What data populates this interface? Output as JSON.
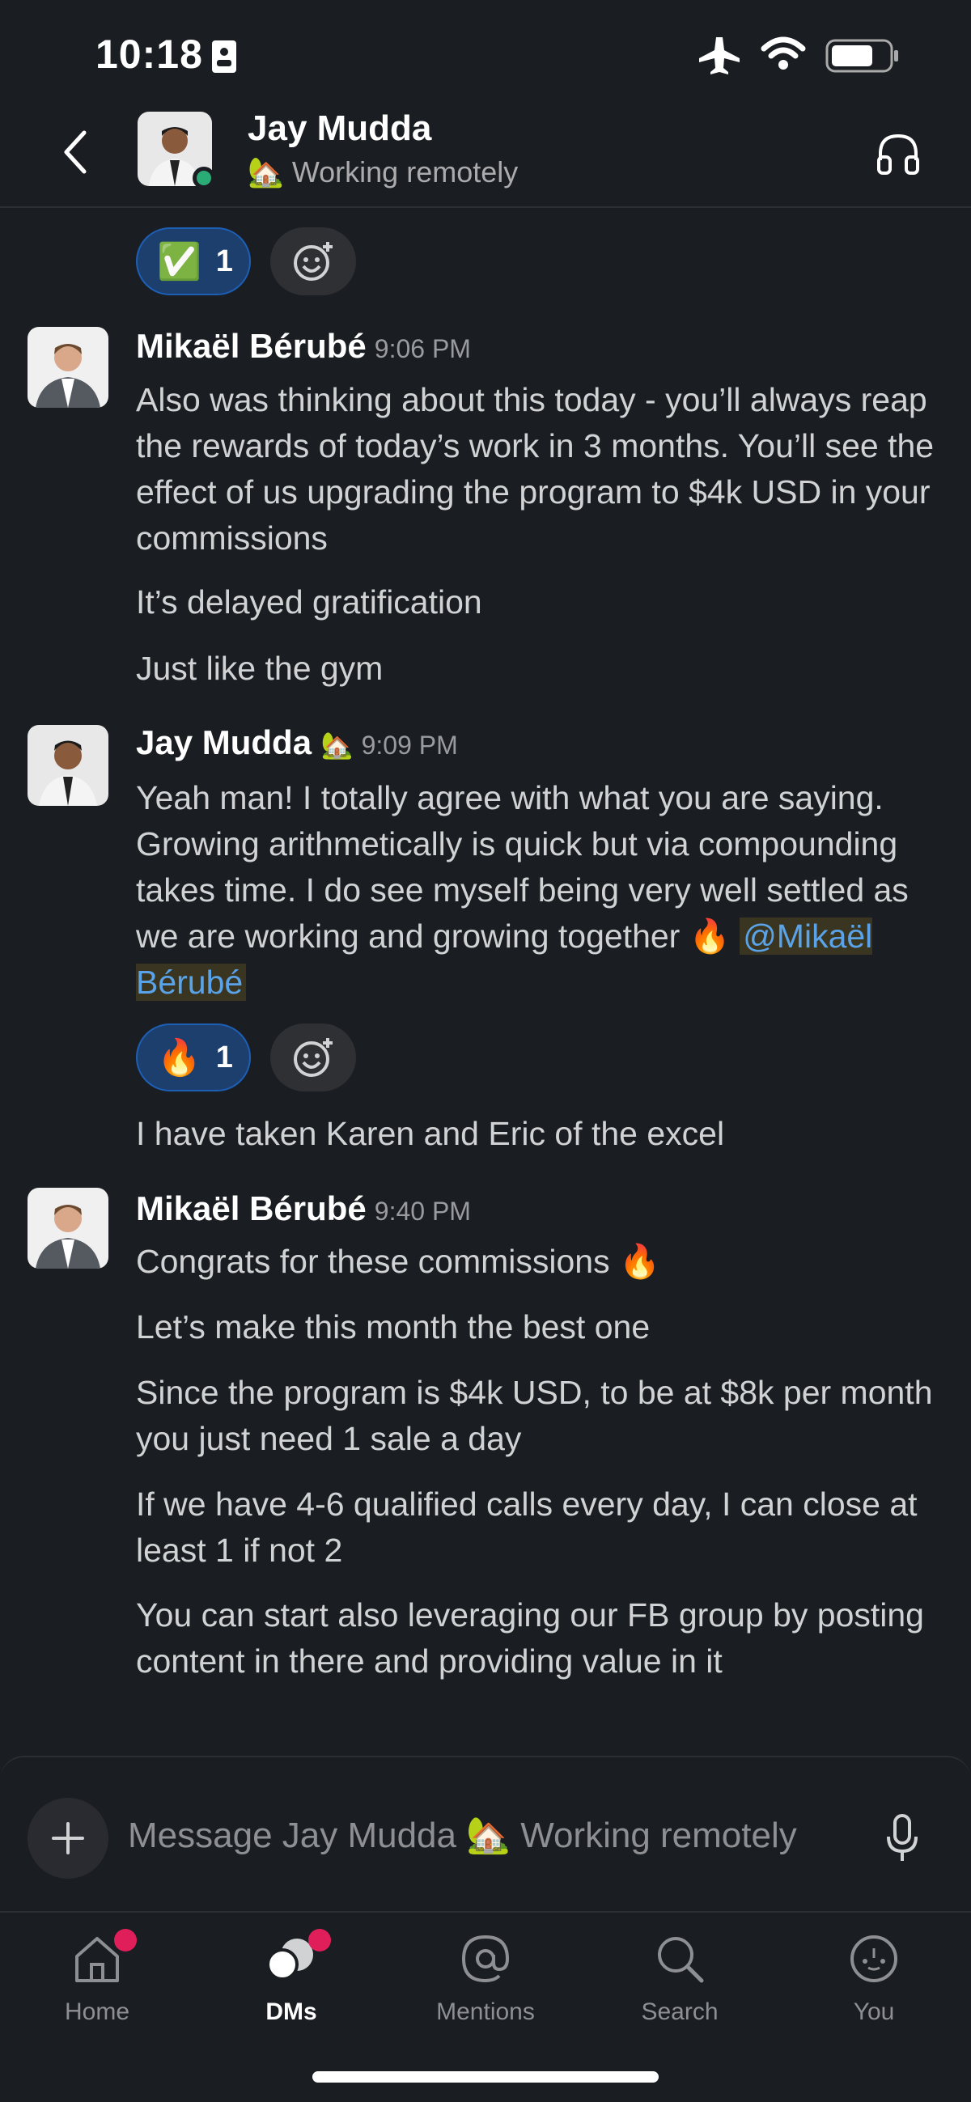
{
  "status_bar": {
    "time": "10:18"
  },
  "header": {
    "name": "Jay Mudda",
    "status": "🏡 Working remotely"
  },
  "reactions": {
    "first": {
      "emoji": "✅",
      "count": "1"
    },
    "second": {
      "emoji": "🔥",
      "count": "1"
    }
  },
  "messages": [
    {
      "author": "Mikaël Bérubé",
      "time": "9:06 PM",
      "lines": [
        "Also was thinking about this today - you’ll always reap the rewards of today’s work in 3 months. You’ll see the effect of us upgrading the program to $4k USD in your commissions",
        "It’s delayed gratification",
        "Just like the gym"
      ]
    },
    {
      "author": "Jay Mudda",
      "author_emoji": "🏡",
      "time": "9:09 PM",
      "lines": [
        "Yeah man! I totally agree with what you are saying. Growing arithmetically is quick but via compounding takes time. I do see myself being very well settled as we are working and growing together 🔥",
        "I have taken Karen and Eric of the excel"
      ],
      "mention": "@Mikaël Bérubé"
    },
    {
      "author": "Mikaël Bérubé",
      "time": "9:40 PM",
      "lines": [
        "Congrats for these commissions 🔥",
        "Let’s make this month the best one",
        "Since the program is $4k USD, to be at $8k per month you just need 1 sale a day",
        "If we have 4-6 qualified calls every day, I can close at least 1 if not 2",
        "You can start also leveraging our FB group by posting content in there and providing value in it"
      ]
    }
  ],
  "composer": {
    "placeholder": "Message Jay Mudda 🏡 Working remotely"
  },
  "tabs": [
    {
      "label": "Home",
      "icon": "home-icon",
      "badge": true
    },
    {
      "label": "DMs",
      "icon": "dms-icon",
      "badge": true,
      "active": true
    },
    {
      "label": "Mentions",
      "icon": "at-icon"
    },
    {
      "label": "Search",
      "icon": "search-icon"
    },
    {
      "label": "You",
      "icon": "profile-icon"
    }
  ],
  "colors": {
    "background": "#1a1d21",
    "accent": "#1d5fb5",
    "badge": "#e01e5a",
    "online": "#2bac76",
    "mention": "#5aa3e8"
  }
}
